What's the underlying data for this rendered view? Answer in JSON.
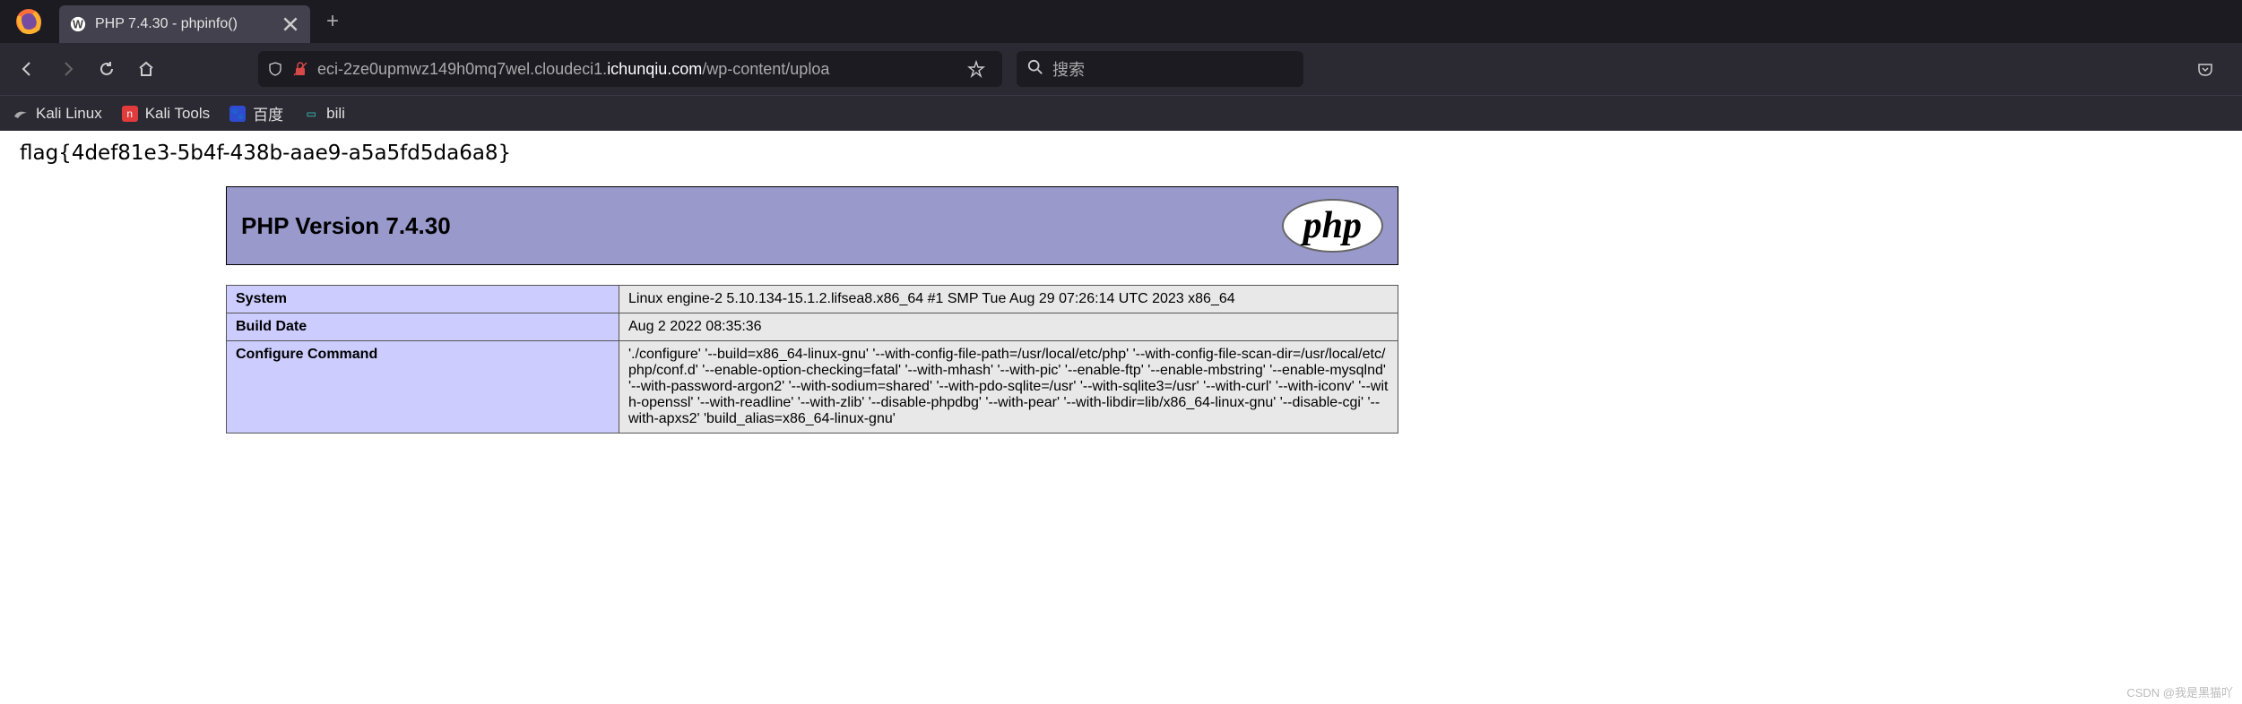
{
  "browser": {
    "tab_title": "PHP 7.4.30 - phpinfo()",
    "url_prefix": "eci-2ze0upmwz149h0mq7wel.cloudeci1.",
    "url_domain": "ichunqiu.com",
    "url_suffix": "/wp-content/uploa",
    "search_placeholder": "搜索"
  },
  "bookmarks": [
    {
      "label": "Kali Linux"
    },
    {
      "label": "Kali Tools"
    },
    {
      "label": "百度"
    },
    {
      "label": "bili"
    }
  ],
  "page": {
    "flag": "flag{4def81e3-5b4f-438b-aae9-a5a5fd5da6a8}",
    "php_version_label": "PHP Version 7.4.30",
    "php_logo": "php",
    "rows": [
      {
        "key": "System",
        "val": "Linux engine-2 5.10.134-15.1.2.lifsea8.x86_64 #1 SMP Tue Aug 29 07:26:14 UTC 2023 x86_64"
      },
      {
        "key": "Build Date",
        "val": "Aug 2 2022 08:35:36"
      },
      {
        "key": "Configure Command",
        "val": "'./configure' '--build=x86_64-linux-gnu' '--with-config-file-path=/usr/local/etc/php' '--with-config-file-scan-dir=/usr/local/etc/php/conf.d' '--enable-option-checking=fatal' '--with-mhash' '--with-pic' '--enable-ftp' '--enable-mbstring' '--enable-mysqlnd' '--with-password-argon2' '--with-sodium=shared' '--with-pdo-sqlite=/usr' '--with-sqlite3=/usr' '--with-curl' '--with-iconv' '--with-openssl' '--with-readline' '--with-zlib' '--disable-phpdbg' '--with-pear' '--with-libdir=lib/x86_64-linux-gnu' '--disable-cgi' '--with-apxs2' 'build_alias=x86_64-linux-gnu'"
      }
    ]
  },
  "watermark": "CSDN @我是黑猫吖"
}
